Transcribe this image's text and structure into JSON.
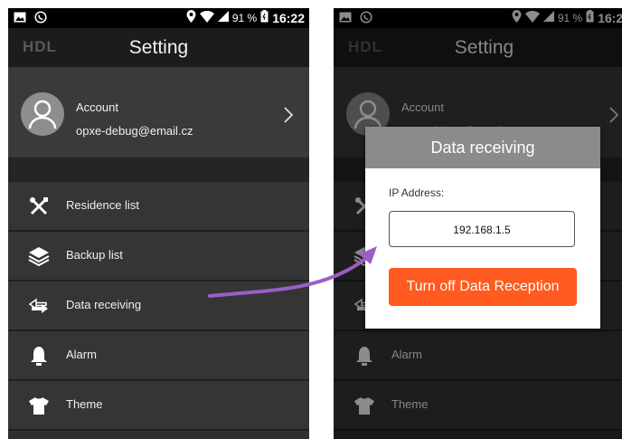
{
  "status_bar": {
    "battery_percent": "91 %",
    "time": "16:22",
    "icons": [
      "image-icon",
      "whatsapp-icon",
      "location-icon",
      "wifi-icon",
      "signal-icon",
      "battery-icon"
    ]
  },
  "app_bar": {
    "logo": "HDL",
    "title": "Setting"
  },
  "account": {
    "label": "Account",
    "email": "opxe-debug@email.cz",
    "icon": "user-icon"
  },
  "menu": [
    {
      "label": "Residence list",
      "icon": "tools-icon"
    },
    {
      "label": "Backup list",
      "icon": "layers-icon"
    },
    {
      "label": "Data receiving",
      "icon": "data-transfer-icon"
    },
    {
      "label": "Alarm",
      "icon": "bell-icon"
    },
    {
      "label": "Theme",
      "icon": "shirt-icon"
    }
  ],
  "dialog": {
    "title": "Data receiving",
    "ip_label": "IP Address:",
    "ip_value": "192.168.1.5",
    "button_label": "Turn off Data Reception"
  },
  "colors": {
    "accent": "#ff5a1f",
    "arrow": "#9a5ec6",
    "dialog_header": "#8b8b8b"
  }
}
